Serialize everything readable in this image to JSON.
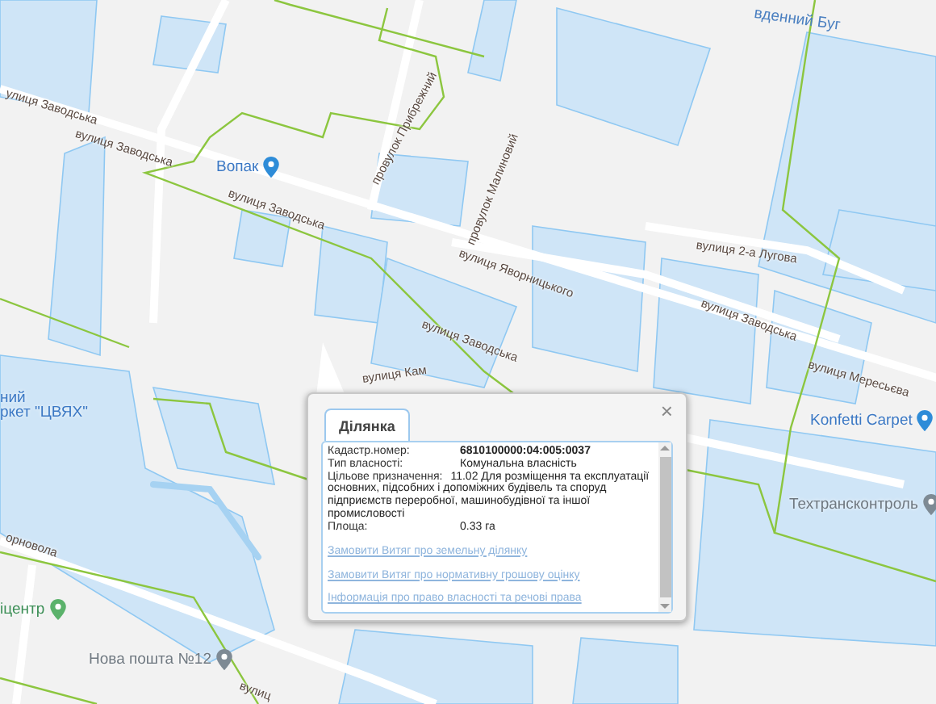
{
  "map": {
    "labels": [
      {
        "text": "вденний Буг",
        "kind": "water"
      },
      {
        "text": "улиця Заводська",
        "kind": "street"
      },
      {
        "text": "вулиця Заводська",
        "kind": "street"
      },
      {
        "text": "вулиця Заводська",
        "kind": "street"
      },
      {
        "text": "вулиця Заводська",
        "kind": "street"
      },
      {
        "text": "вулиця Заводська",
        "kind": "street"
      },
      {
        "text": "провулок Прибрежний",
        "kind": "street"
      },
      {
        "text": "провулок Малиновий",
        "kind": "street"
      },
      {
        "text": "вулиця Яворницького",
        "kind": "street"
      },
      {
        "text": "вулиця 2-а Лугова",
        "kind": "street"
      },
      {
        "text": "вулиця Мересьєва",
        "kind": "street"
      },
      {
        "text": "вулиця Кам",
        "kind": "street"
      },
      {
        "text": "Вопак",
        "kind": "shop"
      },
      {
        "text": "Konfetti Carpet",
        "kind": "shop"
      },
      {
        "text": "Техтрансконтроль",
        "kind": "place"
      },
      {
        "text": "ний",
        "kind": "poi"
      },
      {
        "text": "ркет \"ЦВЯХ\"",
        "kind": "poi"
      },
      {
        "text": "орноволa",
        "kind": "street"
      },
      {
        "text": "іцентр",
        "kind": "park"
      },
      {
        "text": "Нова пошта №12",
        "kind": "place"
      },
      {
        "text": "вулиц",
        "kind": "street"
      }
    ]
  },
  "popup": {
    "tab": {
      "label": "Ділянка",
      "selected": true
    },
    "close": "×",
    "fields": [
      {
        "label": "Кадастр.номер:",
        "value": "6810100000:04:005:0037",
        "kind": "strong"
      },
      {
        "label": "Тип власності:",
        "value": "Комунальна власність",
        "kind": "plain"
      },
      {
        "label": "Цільове призначення:",
        "value": "11.02 Для розміщення та експлуатації основних, підсобних і допоміжних будівель та споруд підприємств переробної, машинобудівної та іншої промисловості",
        "kind": "wrap"
      },
      {
        "label": "Площа:",
        "value": "0.33 га",
        "kind": "plain"
      }
    ],
    "links": [
      "Замовити Витяг про земельну ділянку",
      "Замовити Витяг про нормативну грошову оцінку",
      "Інформація про право власності та речові права"
    ]
  }
}
